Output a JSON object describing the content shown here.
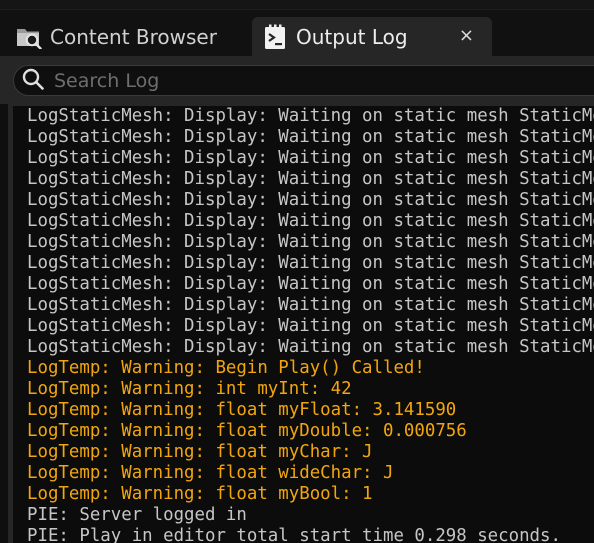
{
  "colors": {
    "background": "#0f0f0f",
    "panel": "#262626",
    "log_background": "#0c0c0c",
    "display_text": "#c6c6c6",
    "warning_text": "#f2a60e"
  },
  "tabs": [
    {
      "label": "Content Browser",
      "icon": "folder-search-icon",
      "active": false
    },
    {
      "label": "Output Log",
      "icon": "output-log-icon",
      "active": true,
      "close_label": "×"
    }
  ],
  "search": {
    "placeholder": "Search Log",
    "value": "",
    "icon": "search-icon"
  },
  "log_lines": [
    {
      "text": "LogStaticMesh: Display: Waiting on static mesh StaticMesh",
      "level": "display"
    },
    {
      "text": "LogStaticMesh: Display: Waiting on static mesh StaticMesh",
      "level": "display"
    },
    {
      "text": "LogStaticMesh: Display: Waiting on static mesh StaticMesh",
      "level": "display"
    },
    {
      "text": "LogStaticMesh: Display: Waiting on static mesh StaticMesh",
      "level": "display"
    },
    {
      "text": "LogStaticMesh: Display: Waiting on static mesh StaticMesh",
      "level": "display"
    },
    {
      "text": "LogStaticMesh: Display: Waiting on static mesh StaticMesh",
      "level": "display"
    },
    {
      "text": "LogStaticMesh: Display: Waiting on static mesh StaticMesh",
      "level": "display"
    },
    {
      "text": "LogStaticMesh: Display: Waiting on static mesh StaticMesh",
      "level": "display"
    },
    {
      "text": "LogStaticMesh: Display: Waiting on static mesh StaticMesh",
      "level": "display"
    },
    {
      "text": "LogStaticMesh: Display: Waiting on static mesh StaticMesh",
      "level": "display"
    },
    {
      "text": "LogStaticMesh: Display: Waiting on static mesh StaticMesh",
      "level": "display"
    },
    {
      "text": "LogStaticMesh: Display: Waiting on static mesh StaticMesh",
      "level": "display"
    },
    {
      "text": "LogTemp: Warning: Begin Play() Called!",
      "level": "warning"
    },
    {
      "text": "LogTemp: Warning: int myInt: 42",
      "level": "warning"
    },
    {
      "text": "LogTemp: Warning: float myFloat: 3.141590",
      "level": "warning"
    },
    {
      "text": "LogTemp: Warning: float myDouble: 0.000756",
      "level": "warning"
    },
    {
      "text": "LogTemp: Warning: float myChar: J",
      "level": "warning"
    },
    {
      "text": "LogTemp: Warning: float wideChar: J",
      "level": "warning"
    },
    {
      "text": "LogTemp: Warning: float myBool: 1",
      "level": "warning"
    },
    {
      "text": "PIE: Server logged in",
      "level": "info"
    },
    {
      "text": "PIE: Play in editor total start time 0.298 seconds.",
      "level": "info"
    }
  ]
}
